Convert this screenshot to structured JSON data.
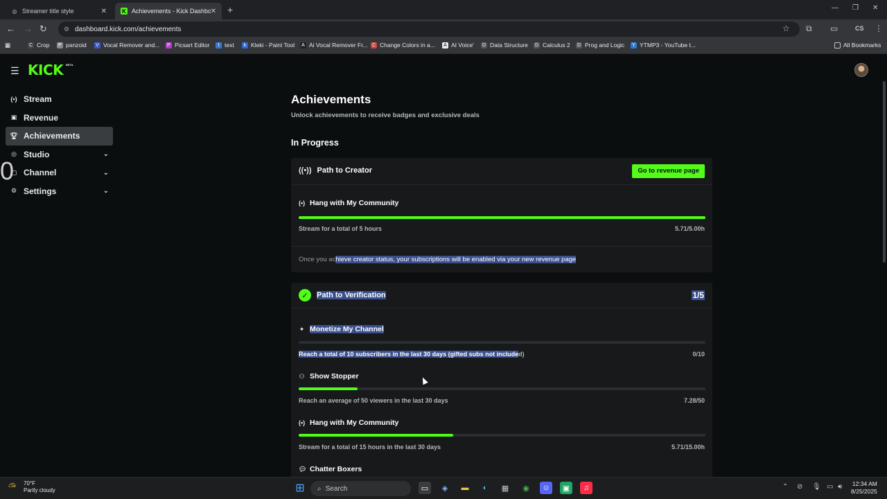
{
  "browser": {
    "tabs": [
      {
        "title": "Streamer title style"
      },
      {
        "title": "Achievements - Kick Dashboard"
      }
    ],
    "url": "dashboard.kick.com/achievements",
    "bookmarks": [
      {
        "label": "Crop",
        "color": "#444"
      },
      {
        "label": "panzoid",
        "color": "#888"
      },
      {
        "label": "Vocal Remover and...",
        "color": "#3a56c9"
      },
      {
        "label": "Picsart Editor",
        "color": "#b83ad1"
      },
      {
        "label": "text",
        "color": "#3a76d1"
      },
      {
        "label": "Kleki - Paint Tool",
        "color": "#2f66d6"
      },
      {
        "label": "Ai Vocal Remover Fr...",
        "color": "#222"
      },
      {
        "label": "Change Colors in a...",
        "color": "#c9443a"
      },
      {
        "label": "AI Voice'",
        "color": "#eee"
      },
      {
        "label": "Data Structure",
        "color": "#555"
      },
      {
        "label": "Calculus 2",
        "color": "#555"
      },
      {
        "label": "Prog and Logic",
        "color": "#555"
      },
      {
        "label": "YTMP3 - YouTube t...",
        "color": "#2a7ad1"
      }
    ],
    "all_bookmarks": "All Bookmarks"
  },
  "brand": {
    "logo": "KICK",
    "badge": "BETA",
    "accent": "#53fc18"
  },
  "sidebar": {
    "items": [
      {
        "label": "Stream",
        "icon": "broadcast-icon"
      },
      {
        "label": "Revenue",
        "icon": "revenue-icon"
      },
      {
        "label": "Achievements",
        "icon": "trophy-icon"
      },
      {
        "label": "Studio",
        "icon": "studio-icon"
      },
      {
        "label": "Channel",
        "icon": "channel-icon"
      },
      {
        "label": "Settings",
        "icon": "gear-icon"
      }
    ],
    "overlay_digit": "0"
  },
  "main": {
    "title": "Achievements",
    "subtitle": "Unlock achievements to receive badges and exclusive deals",
    "section": "In Progress",
    "creator": {
      "title": "Path to Creator",
      "button": "Go to revenue page",
      "achievement": {
        "name": "Hang with My Community",
        "desc": "Stream for a total of 5 hours",
        "value": "5.71/5.00h",
        "progress": 1.0
      },
      "note_pre": "Once you ac",
      "note_sel": "hieve creator status, your subscriptions will be enabled via your new revenue page"
    },
    "verification": {
      "title": "Path to Verification",
      "count": "1/5",
      "achievements": [
        {
          "name": "Monetize My Channel",
          "desc_sel": "Reach a total of 10 subscribers in the last 30 days (gifted subs not include",
          "desc_rest": "d)",
          "value": "0/10",
          "progress": 0.0
        },
        {
          "name": "Show Stopper",
          "desc": "Reach an average of 50 viewers in the last 30 days",
          "value": "7.28/50",
          "progress": 0.1456
        },
        {
          "name": "Hang with My Community",
          "desc": "Stream for a total of 15 hours in the last 30 days",
          "value": "5.71/15.00h",
          "progress": 0.38
        },
        {
          "name": "Chatter Boxers"
        }
      ]
    }
  },
  "taskbar": {
    "weather_temp": "70°F",
    "weather_desc": "Partly cloudy",
    "search": "Search",
    "time": "12:34 AM",
    "date": "8/25/2025"
  }
}
